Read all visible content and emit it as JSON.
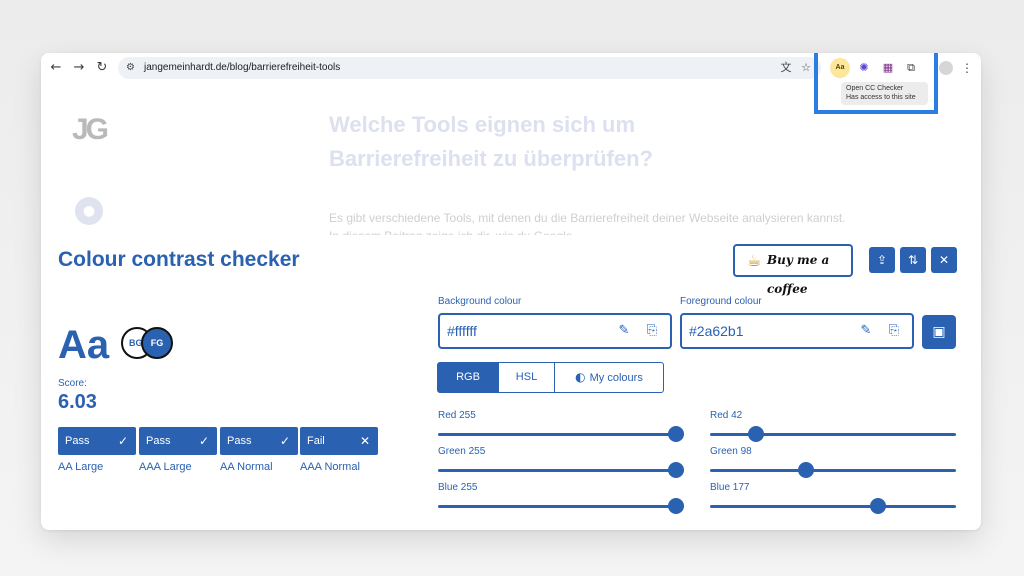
{
  "browser": {
    "url": "jangemeinhardt.de/blog/barrierefreiheit-tools",
    "icons": {
      "back": "arrow-left-icon",
      "forward": "arrow-right-icon",
      "reload": "reload-icon",
      "site_settings": "tune-icon",
      "translate": "translate-icon",
      "bookmark": "star-icon",
      "extensions": "puzzle-icon",
      "menu": "more-vertical-icon"
    },
    "extension_aa_label": "Aa",
    "tooltip": {
      "line1": "Open CC Checker",
      "line2": "Has access to this site"
    },
    "highlight_color": "#2b7ce3"
  },
  "page": {
    "logo": "JG",
    "heading": "Welche Tools eignen sich um Barrierefreiheit zu überprüfen?",
    "paragraph": "Es gibt verschiedene Tools, mit denen du die Barrierefreiheit deiner Webseite analysieren kannst. In diesem Beitrag zeige ich dir, wie du Google"
  },
  "checker": {
    "title": "Colour contrast checker",
    "coffee_label": "Buy me a coffee",
    "accent_color": "#2a62b1",
    "preview_text": "Aa",
    "bg_short": "BG",
    "fg_short": "FG",
    "score_label": "Score:",
    "score": "6.03",
    "results": [
      {
        "status": "Pass",
        "icon": "✓",
        "label": "AA Large"
      },
      {
        "status": "Pass",
        "icon": "✓",
        "label": "AAA Large"
      },
      {
        "status": "Pass",
        "icon": "✓",
        "label": "AA Normal"
      },
      {
        "status": "Fail",
        "icon": "✕",
        "label": "AAA Normal"
      }
    ],
    "background": {
      "label": "Background colour",
      "value": "#ffffff"
    },
    "foreground": {
      "label": "Foreground colour",
      "value": "#2a62b1"
    },
    "tabs": [
      "RGB",
      "HSL",
      "My colours"
    ],
    "active_tab": "RGB",
    "bg_channels": [
      {
        "label": "Red 255",
        "value": 255
      },
      {
        "label": "Green 255",
        "value": 255
      },
      {
        "label": "Blue 255",
        "value": 255
      }
    ],
    "fg_channels": [
      {
        "label": "Red 42",
        "value": 42
      },
      {
        "label": "Green 98",
        "value": 98
      },
      {
        "label": "Blue 177",
        "value": 177
      }
    ]
  }
}
